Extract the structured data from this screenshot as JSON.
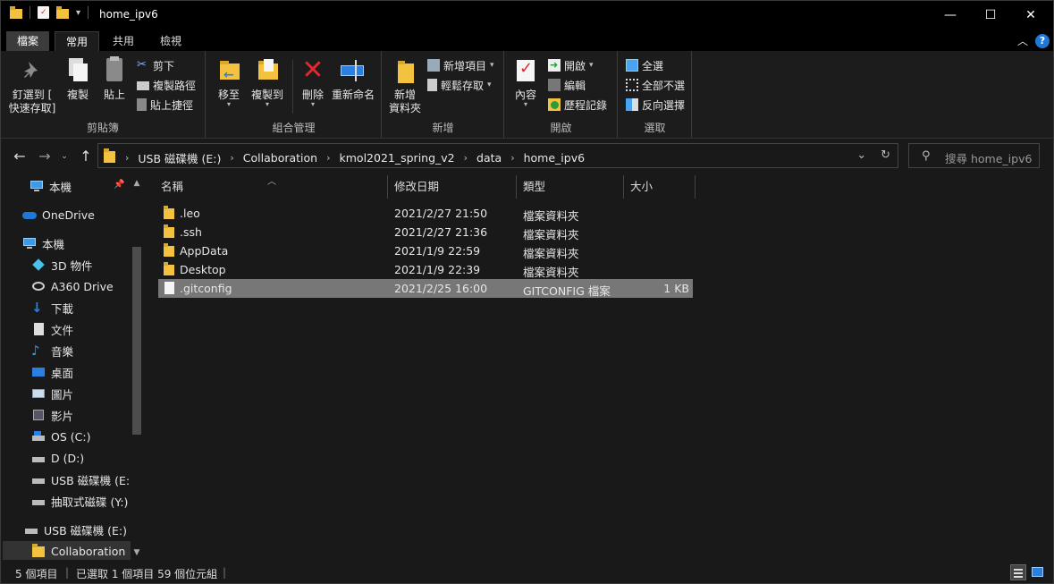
{
  "window": {
    "title": "home_ipv6",
    "minimize": "—",
    "maximize": "☐",
    "close": "✕"
  },
  "ribbon_tabs": [
    "檔案",
    "常用",
    "共用",
    "檢視"
  ],
  "ribbon": {
    "clipboard": {
      "label": "剪貼簿",
      "pin_line1": "釘選到 [",
      "pin_line2": "快速存取]",
      "copy": "複製",
      "paste": "貼上",
      "cut": "剪下",
      "copy_path": "複製路徑",
      "paste_shortcut": "貼上捷徑"
    },
    "organize": {
      "label": "組合管理",
      "move_to": "移至",
      "copy_to": "複製到",
      "delete": "刪除",
      "rename": "重新命名"
    },
    "new": {
      "label": "新增",
      "new_folder_line1": "新增",
      "new_folder_line2": "資料夾",
      "new_item": "新增項目",
      "easy_access": "輕鬆存取"
    },
    "open": {
      "label": "開啟",
      "properties": "內容",
      "open": "開啟",
      "edit": "編輯",
      "history": "歷程記錄"
    },
    "select": {
      "label": "選取",
      "select_all": "全選",
      "select_none": "全部不選",
      "invert": "反向選擇"
    }
  },
  "address": {
    "crumbs": [
      "USB 磁碟機 (E:)",
      "Collaboration",
      "kmol2021_spring_v2",
      "data",
      "home_ipv6"
    ],
    "search_placeholder": "搜尋 home_ipv6"
  },
  "nav_pane": {
    "items": [
      {
        "label": "本機",
        "icon": "pc-icon"
      },
      {
        "label": "OneDrive",
        "icon": "onedrive-icon"
      },
      {
        "label": "本機",
        "icon": "pc-icon"
      },
      {
        "label": "3D 物件",
        "icon": "3d-objects-icon"
      },
      {
        "label": "A360 Drive",
        "icon": "a360-drive-icon"
      },
      {
        "label": "下載",
        "icon": "download-icon"
      },
      {
        "label": "文件",
        "icon": "documents-icon"
      },
      {
        "label": "音樂",
        "icon": "music-icon"
      },
      {
        "label": "桌面",
        "icon": "desktop-icon"
      },
      {
        "label": "圖片",
        "icon": "pictures-icon"
      },
      {
        "label": "影片",
        "icon": "videos-icon"
      },
      {
        "label": "OS (C:)",
        "icon": "os-drive-icon"
      },
      {
        "label": "D (D:)",
        "icon": "drive-icon"
      },
      {
        "label": "USB 磁碟機 (E:)",
        "icon": "usb-drive-icon"
      },
      {
        "label": "抽取式磁碟 (Y:)",
        "icon": "removable-drive-icon"
      },
      {
        "label": "USB 磁碟機 (E:)",
        "icon": "usb-drive-icon"
      },
      {
        "label": "Collaboration",
        "icon": "folder-icon"
      }
    ]
  },
  "columns": [
    "名稱",
    "修改日期",
    "類型",
    "大小"
  ],
  "files": [
    {
      "name": ".leo",
      "date": "2021/2/27 21:50",
      "type": "檔案資料夾",
      "size": "",
      "icon": "folder-icon"
    },
    {
      "name": ".ssh",
      "date": "2021/2/27 21:36",
      "type": "檔案資料夾",
      "size": "",
      "icon": "folder-icon"
    },
    {
      "name": "AppData",
      "date": "2021/1/9 22:59",
      "type": "檔案資料夾",
      "size": "",
      "icon": "folder-icon"
    },
    {
      "name": "Desktop",
      "date": "2021/1/9 22:39",
      "type": "檔案資料夾",
      "size": "",
      "icon": "folder-icon"
    },
    {
      "name": ".gitconfig",
      "date": "2021/2/25 16:00",
      "type": "GITCONFIG 檔案",
      "size": "1 KB",
      "icon": "file-icon"
    }
  ],
  "status": {
    "count": "5 個項目",
    "selected": "已選取 1 個項目  59 個位元組"
  }
}
